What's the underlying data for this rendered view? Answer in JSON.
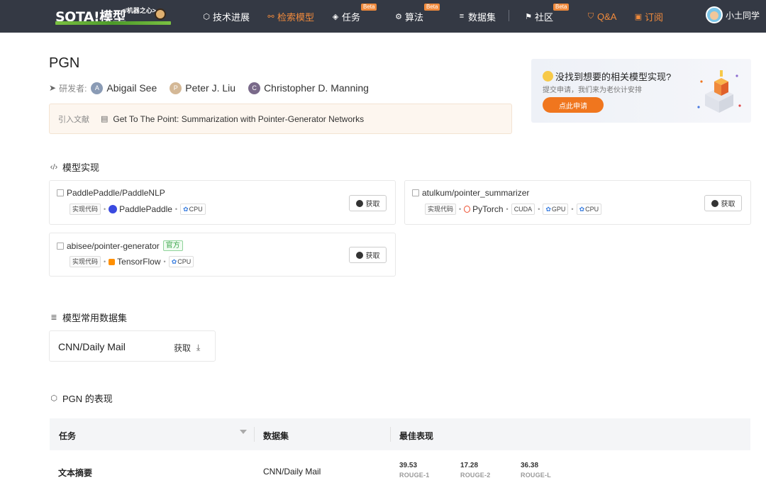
{
  "nav": {
    "logo_text": "SOTA!模型",
    "logo_sub": "</机器之心>",
    "items": [
      {
        "label": "技术进展",
        "icon": "hexagon-icon",
        "beta": ""
      },
      {
        "label": "检索模型",
        "icon": "network-icon",
        "beta": ""
      },
      {
        "label": "任务",
        "icon": "layers-icon",
        "beta": "Beta"
      },
      {
        "label": "算法",
        "icon": "algorithm-icon",
        "beta": "Beta"
      },
      {
        "label": "数据集",
        "icon": "database-icon",
        "beta": ""
      },
      {
        "label": "社区",
        "icon": "flag-icon",
        "beta": "Beta"
      },
      {
        "label": "Q&A",
        "icon": "shield-icon",
        "beta": ""
      },
      {
        "label": "订阅",
        "icon": "bookmark-icon",
        "beta": ""
      }
    ],
    "user": "小土同学",
    "accent": "#f08a3c"
  },
  "model": {
    "title": "PGN",
    "authors_label": "研发者:",
    "authors": [
      {
        "initial": "A",
        "name": "Abigail See",
        "color": "#8a9bb5"
      },
      {
        "initial": "P",
        "name": "Peter J. Liu",
        "color": "#d4b896"
      },
      {
        "initial": "C",
        "name": "Christopher D. Manning",
        "color": "#7a6a8a"
      }
    ],
    "ref_label": "引入文献",
    "ref_text": "Get To The Point: Summarization with Pointer-Generator Networks"
  },
  "banner": {
    "title": "没找到想要的相关模型实现?",
    "subtitle": "提交申请，我们来为老伙计安排",
    "button": "点此申请"
  },
  "implementations": {
    "heading": "模型实现",
    "get_label": "获取",
    "code_tag": "实现代码",
    "items": [
      {
        "repo": "PaddlePaddle/PaddleNLP",
        "official": "",
        "framework": "PaddlePaddle",
        "chips": [
          "CPU"
        ]
      },
      {
        "repo": "atulkum/pointer_summarizer",
        "official": "",
        "framework": "PyTorch",
        "cuda": "CUDA",
        "chips": [
          "GPU",
          "CPU"
        ]
      },
      {
        "repo": "abisee/pointer-generator",
        "official": "官方",
        "framework": "TensorFlow",
        "chips": [
          "CPU"
        ]
      }
    ]
  },
  "datasets": {
    "heading": "模型常用数据集",
    "items": [
      {
        "name": "CNN/Daily Mail",
        "get": "获取"
      }
    ]
  },
  "performance": {
    "heading": "PGN 的表现",
    "columns": [
      "任务",
      "数据集",
      "最佳表现"
    ],
    "rows": [
      {
        "task": "文本摘要",
        "dataset": "CNN/Daily Mail",
        "metrics": [
          {
            "value": "39.53",
            "name": "ROUGE-1"
          },
          {
            "value": "17.28",
            "name": "ROUGE-2"
          },
          {
            "value": "36.38",
            "name": "ROUGE-L"
          }
        ]
      }
    ]
  }
}
